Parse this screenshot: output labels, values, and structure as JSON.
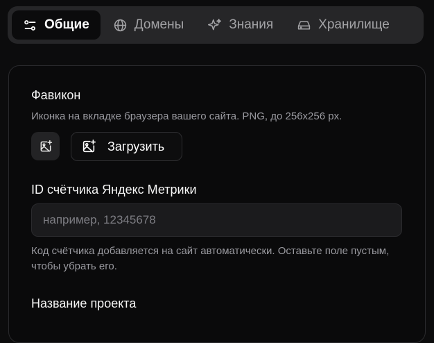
{
  "tabs": [
    {
      "label": "Общие",
      "icon": "sliders-icon",
      "active": true
    },
    {
      "label": "Домены",
      "icon": "globe-icon",
      "active": false
    },
    {
      "label": "Знания",
      "icon": "sparkles-icon",
      "active": false
    },
    {
      "label": "Хранилище",
      "icon": "hard-drive-icon",
      "active": false
    }
  ],
  "favicon": {
    "title": "Фавикон",
    "hint": "Иконка на вкладке браузера вашего сайта. PNG, до 256x256 px.",
    "upload_label": "Загрузить",
    "preview_icon": "image-plus-icon"
  },
  "metrika": {
    "title": "ID счётчика Яндекс Метрики",
    "placeholder": "например, 12345678",
    "value": "",
    "hint": "Код счётчика добавляется на сайт автоматически. Оставьте поле пустым, чтобы убрать его."
  },
  "project": {
    "title": "Название проекта"
  },
  "colors": {
    "background": "#0c0c0d",
    "tabbar": "#262628",
    "active_tab": "#0b0b0c",
    "input_bg": "#1b1b1d",
    "muted_text": "#9a9aa0"
  }
}
